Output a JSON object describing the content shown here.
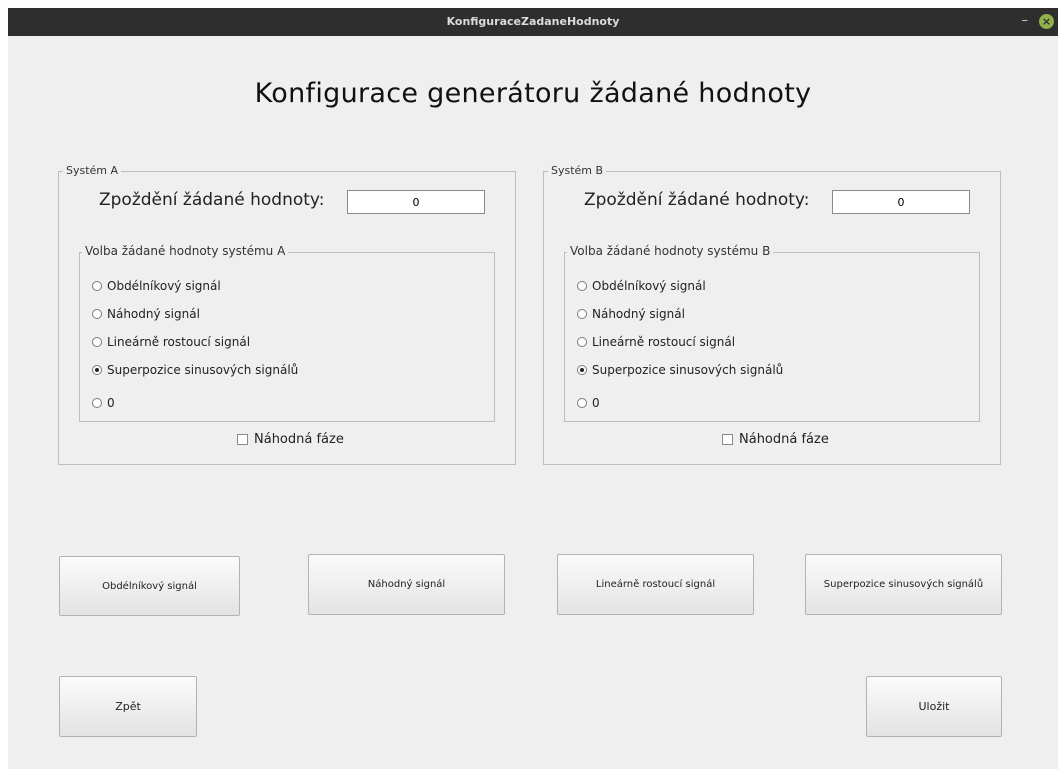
{
  "window": {
    "title": "KonfiguraceZadaneHodnoty",
    "minimize_glyph": "–",
    "close_glyph": "×"
  },
  "heading": "Konfigurace generátoru žádané hodnoty",
  "systems": [
    {
      "legend": "Systém A",
      "delay_label": "Zpoždění žádané hodnoty:",
      "delay_value": "0",
      "group_legend": "Volba žádané hodnoty systému A",
      "options": [
        "Obdélníkový signál",
        "Náhodný signál",
        "Lineárně rostoucí signál",
        "Superpozice sinusových signálů",
        "0"
      ],
      "selected": "Superpozice sinusových signálů",
      "random_phase_label": "Náhodná fáze",
      "random_phase_checked": false
    },
    {
      "legend": "Systém B",
      "delay_label": "Zpoždění žádané hodnoty:",
      "delay_value": "0",
      "group_legend": "Volba žádané hodnoty systému B",
      "options": [
        "Obdélníkový signál",
        "Náhodný signál",
        "Lineárně rostoucí signál",
        "Superpozice sinusových signálů",
        "0"
      ],
      "selected": "Superpozice sinusových signálů",
      "random_phase_label": "Náhodná fáze",
      "random_phase_checked": false
    }
  ],
  "signal_buttons": [
    "Obdélníkový signál",
    "Náhodný signál",
    "Lineárně rostoucí signál",
    "Superpozice sinusových signálů"
  ],
  "footer": {
    "back_label": "Zpět",
    "save_label": "Uložit"
  },
  "colors": {
    "titlebar": "#2e2e2e",
    "window_bg": "#efefef",
    "close_button": "#8fb04a"
  }
}
